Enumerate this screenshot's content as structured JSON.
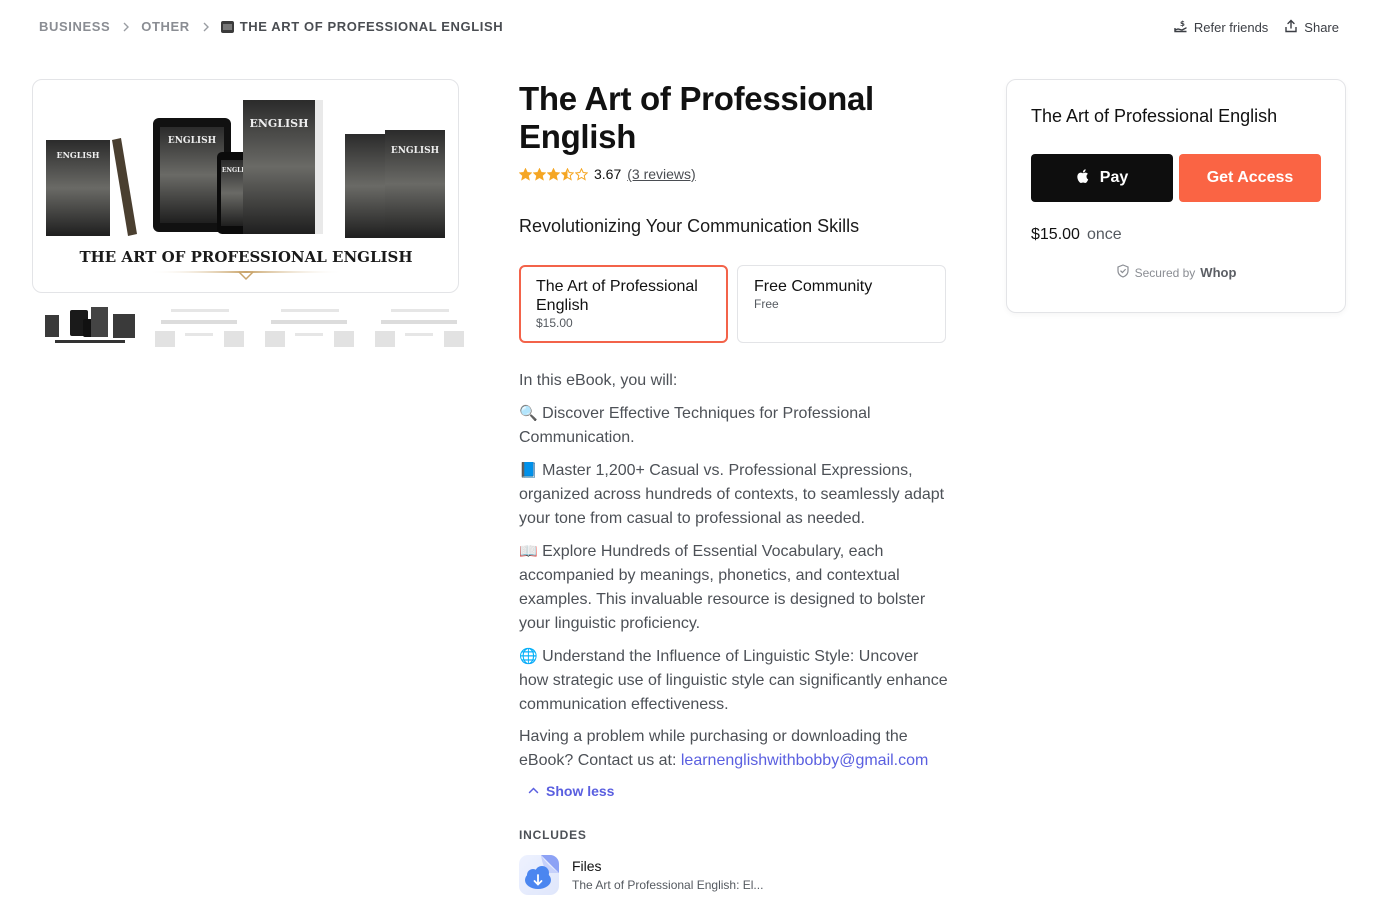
{
  "breadcrumb": {
    "items": [
      "BUSINESS",
      "OTHER"
    ],
    "current": "THE ART OF PROFESSIONAL ENGLISH"
  },
  "top_actions": {
    "refer": "Refer friends",
    "share": "Share"
  },
  "gallery": {
    "main_image_alt": "THE ART OF PROFESSIONAL ENGLISH",
    "main_caption": "THE ART OF PROFESSIONAL ENGLISH",
    "book_cover_text": "THE ART OF PROFESSIONAL ENGLISH",
    "thumbnail_count": 4,
    "selected_thumbnail": 1
  },
  "product": {
    "title": "The Art of Professional English",
    "rating": {
      "value": "3.67",
      "stars_out_of_5": 3.67,
      "reviews_label": "(3 reviews)"
    },
    "subtitle": "Revolutionizing Your Communication Skills"
  },
  "plans": [
    {
      "name": "The Art of Professional English",
      "price": "$15.00",
      "selected": true
    },
    {
      "name": "Free Community",
      "price": "Free",
      "selected": false
    }
  ],
  "description": {
    "intro": "In this eBook, you will:",
    "bullets": [
      {
        "emoji": "🔍",
        "icon": "magnifier-icon",
        "text": " Discover Effective Techniques for Professional Communication."
      },
      {
        "emoji": "📘",
        "icon": "blue-book-icon",
        "text": " Master 1,200+ Casual vs. Professional Expressions, organized across hundreds of contexts, to seamlessly adapt your tone from casual to professional as needed."
      },
      {
        "emoji": "📖",
        "icon": "open-book-icon",
        "text": " Explore Hundreds of Essential Vocabulary, each accompanied by meanings, phonetics, and contextual examples. This invaluable resource is designed to bolster your linguistic proficiency."
      },
      {
        "emoji": "🌐",
        "icon": "globe-icon",
        "text": " Understand the Influence of Linguistic Style: Uncover how strategic use of linguistic style can significantly enhance communication effectiveness."
      }
    ],
    "contact_text": "Having a problem while purchasing or downloading the eBook? Contact us at: ",
    "contact_email": "learnenglishwithbobby@gmail.com",
    "toggle_label": "Show less"
  },
  "includes": {
    "label": "INCLUDES",
    "items": [
      {
        "title": "Files",
        "subtitle": "The Art of Professional English: El..."
      }
    ]
  },
  "checkout": {
    "title": "The Art of Professional English",
    "apple_pay_label": "Pay",
    "get_access_label": "Get Access",
    "price": "$15.00",
    "period": "once",
    "secured_by": "Secured by",
    "brand": "Whop"
  },
  "colors": {
    "accent": "#fa6444",
    "selected_border": "#f3634a",
    "link": "#5a5fe0",
    "star": "#f5a623"
  }
}
